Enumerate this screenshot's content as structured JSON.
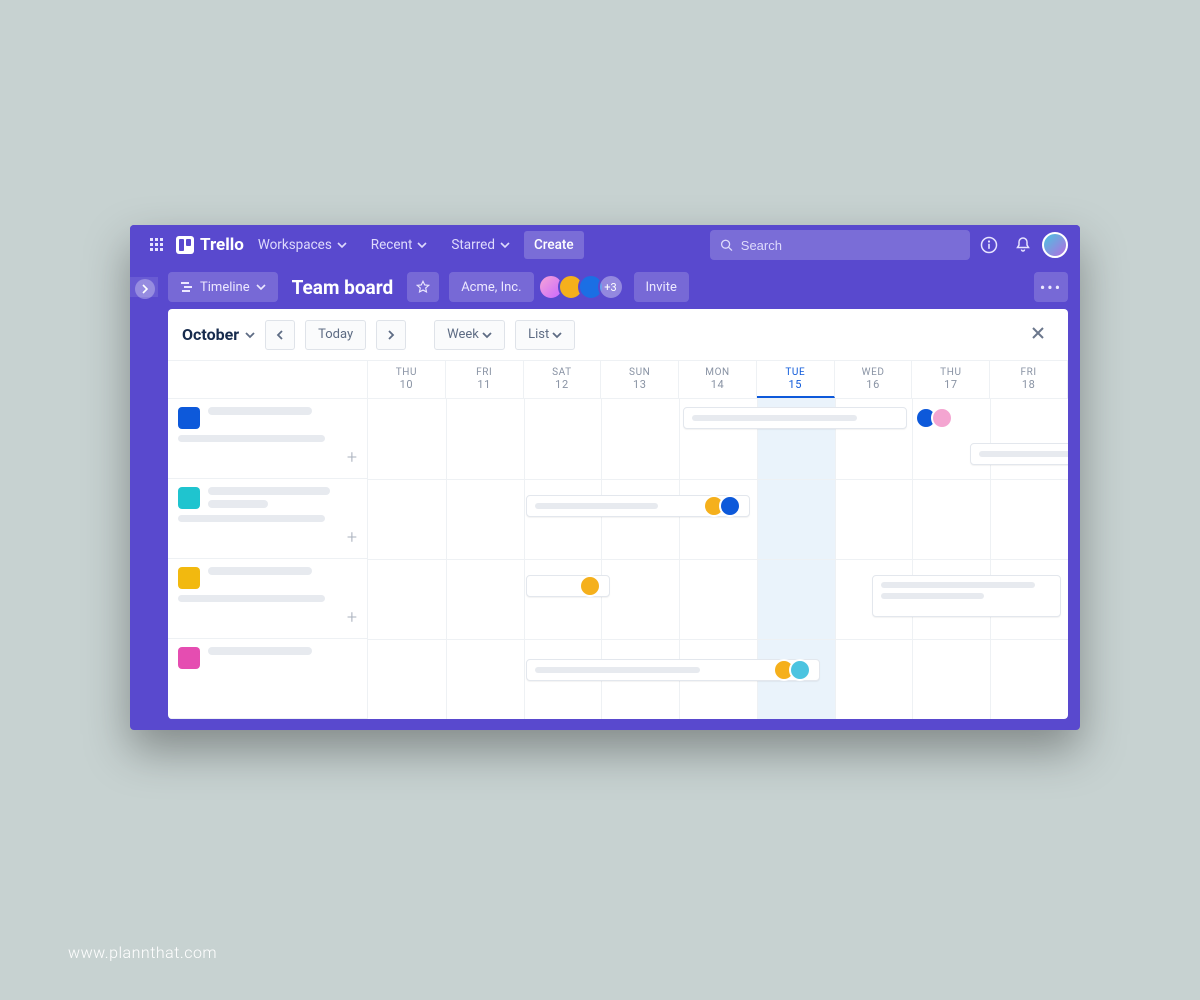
{
  "watermark": "www.plannthat.com",
  "topnav": {
    "brand": "Trello",
    "workspaces": "Workspaces",
    "recent": "Recent",
    "starred": "Starred",
    "create": "Create",
    "search_placeholder": "Search"
  },
  "boardbar": {
    "view_label": "Timeline",
    "title": "Team board",
    "workspace_name": "Acme, Inc.",
    "member_overflow": "+3",
    "invite": "Invite"
  },
  "timeline": {
    "month": "October",
    "today_btn": "Today",
    "range_btn": "Week",
    "display_btn": "List",
    "days": [
      {
        "dow": "THU",
        "num": "10"
      },
      {
        "dow": "FRI",
        "num": "11"
      },
      {
        "dow": "SAT",
        "num": "12"
      },
      {
        "dow": "SUN",
        "num": "13"
      },
      {
        "dow": "MON",
        "num": "14"
      },
      {
        "dow": "TUE",
        "num": "15",
        "today": true
      },
      {
        "dow": "WED",
        "num": "16"
      },
      {
        "dow": "THU",
        "num": "17"
      },
      {
        "dow": "FRI",
        "num": "18"
      }
    ]
  }
}
